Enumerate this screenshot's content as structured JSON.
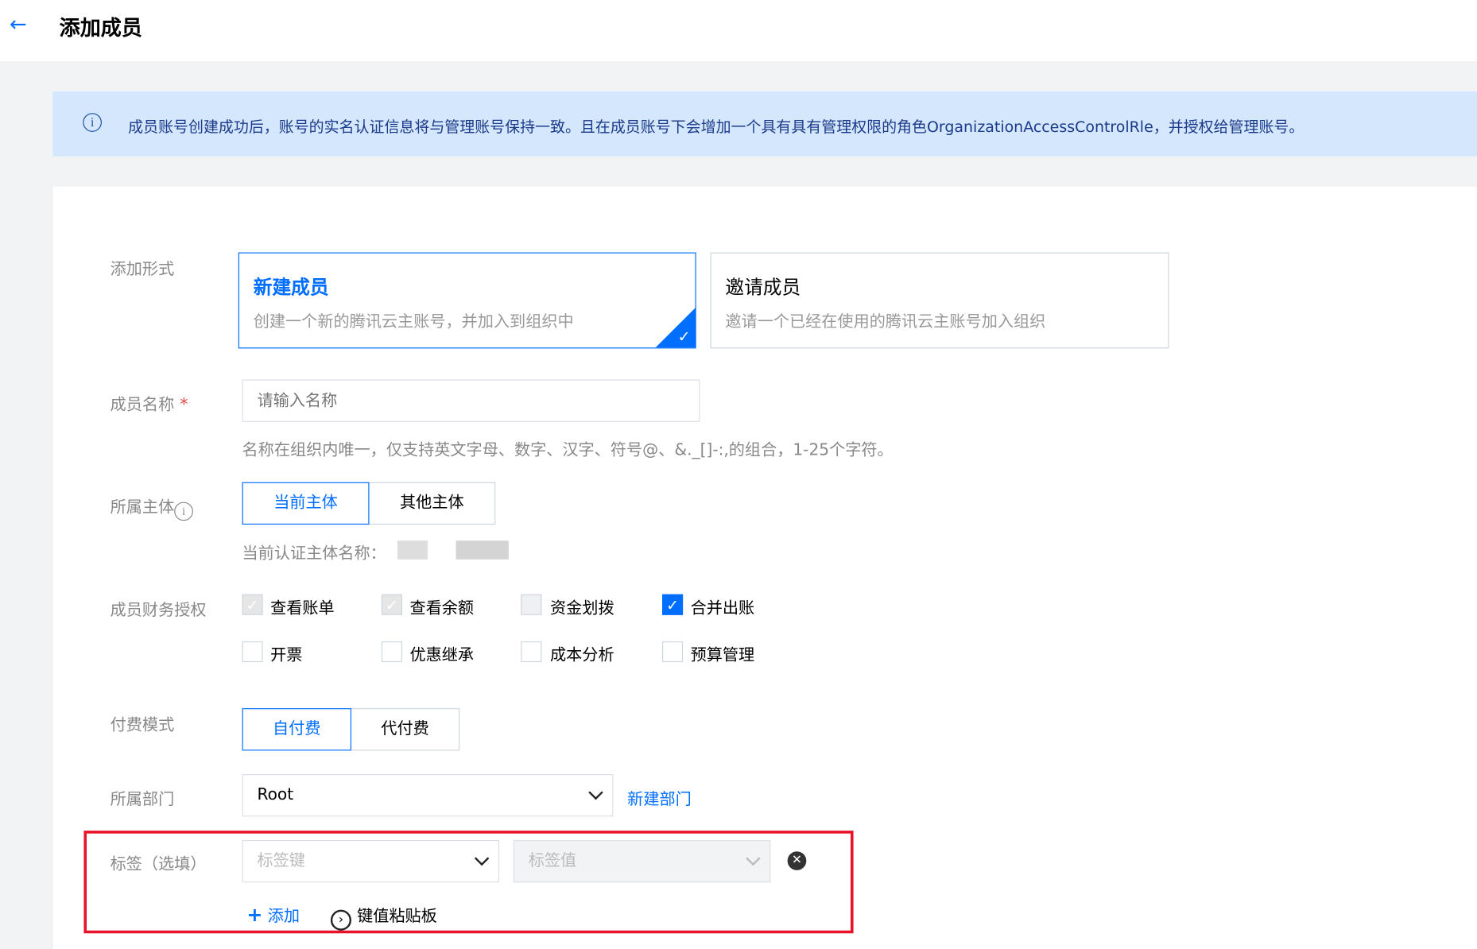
{
  "header": {
    "back_icon": "arrow-left-icon",
    "title": "添加成员"
  },
  "banner": {
    "icon": "info-icon",
    "text": "成员账号创建成功后，账号的实名认证信息将与管理账号保持一致。且在成员账号下会增加一个具有具有管理权限的角色OrganizationAccessControlRle，并授权给管理账号。"
  },
  "form": {
    "add_type": {
      "label": "添加形式",
      "options": [
        {
          "title": "新建成员",
          "desc": "创建一个新的腾讯云主账号，并加入到组织中",
          "selected": true
        },
        {
          "title": "邀请成员",
          "desc": "邀请一个已经在使用的腾讯云主账号加入组织",
          "selected": false
        }
      ]
    },
    "member_name": {
      "label": "成员名称",
      "required_mark": "*",
      "placeholder": "请输入名称",
      "value": "",
      "hint": "名称在组织内唯一，仅支持英文字母、数字、汉字、符号@、&._[]-:,的组合，1-25个字符。"
    },
    "entity": {
      "label": "所属主体",
      "info_icon": "info-circle-icon",
      "options": [
        "当前主体",
        "其他主体"
      ],
      "selected": "当前主体",
      "current_label": "当前认证主体名称："
    },
    "finance": {
      "label": "成员财务授权",
      "items": [
        {
          "label": "查看账单",
          "checked": true,
          "disabled": true
        },
        {
          "label": "查看余额",
          "checked": true,
          "disabled": true
        },
        {
          "label": "资金划拨",
          "checked": false,
          "disabled": true
        },
        {
          "label": "合并出账",
          "checked": true,
          "disabled": false
        },
        {
          "label": "开票",
          "checked": false,
          "disabled": false
        },
        {
          "label": "优惠继承",
          "checked": false,
          "disabled": false
        },
        {
          "label": "成本分析",
          "checked": false,
          "disabled": false
        },
        {
          "label": "预算管理",
          "checked": false,
          "disabled": false
        }
      ]
    },
    "pay_mode": {
      "label": "付费模式",
      "options": [
        "自付费",
        "代付费"
      ],
      "selected": "自付费"
    },
    "department": {
      "label": "所属部门",
      "value": "Root",
      "new_link": "新建部门"
    },
    "tags": {
      "label": "标签（选填）",
      "key_placeholder": "标签键",
      "value_placeholder": "标签值",
      "add_label": "添加",
      "add_icon": "plus-icon",
      "paste_label": "键值粘贴板",
      "paste_icon": "chevron-right-circle-icon",
      "remove_icon": "close-circle-icon"
    }
  },
  "colors": {
    "accent": "#006eff",
    "banner_bg": "#d5e7fd",
    "highlight": "#e8132b"
  }
}
